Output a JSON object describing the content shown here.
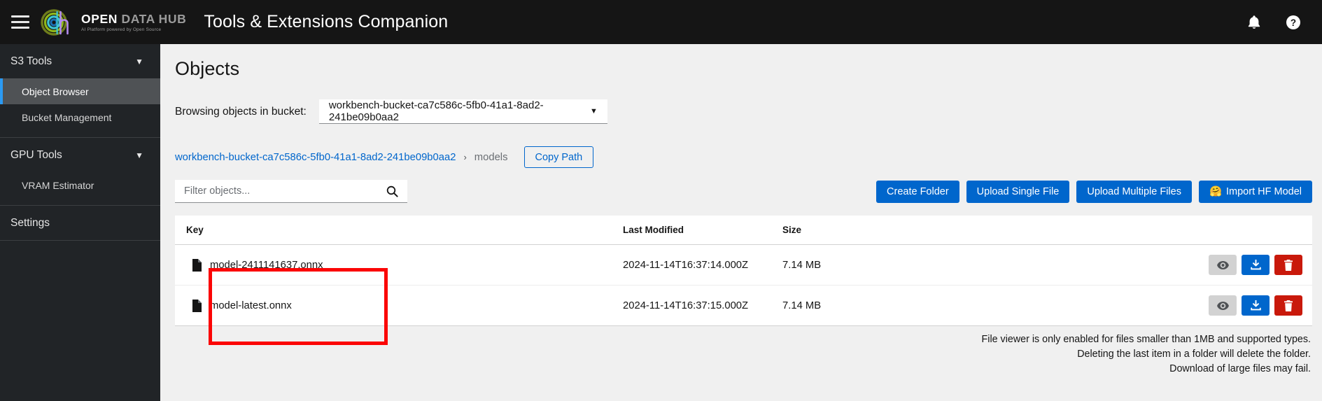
{
  "masthead": {
    "menu_icon": "hamburger-icon",
    "logo": {
      "open": "OPEN",
      "datahub": "DATA HUB",
      "tagline": "AI Platform powered by Open Source"
    },
    "app_title": "Tools & Extensions Companion",
    "notifications_icon": "bell-icon",
    "help_icon": "help-circle-icon"
  },
  "sidebar": {
    "groups": [
      {
        "label": "S3 Tools",
        "expanded": true,
        "items": [
          {
            "label": "Object Browser",
            "active": true
          },
          {
            "label": "Bucket Management",
            "active": false
          }
        ]
      },
      {
        "label": "GPU Tools",
        "expanded": true,
        "items": [
          {
            "label": "VRAM Estimator",
            "active": false
          }
        ]
      }
    ],
    "settings_label": "Settings"
  },
  "main": {
    "page_title": "Objects",
    "bucket": {
      "label": "Browsing objects in bucket:",
      "selected": "workbench-bucket-ca7c586c-5fb0-41a1-8ad2-241be09b0aa2",
      "caret_icon": "chevron-down-icon"
    },
    "breadcrumb": {
      "root": "workbench-bucket-ca7c586c-5fb0-41a1-8ad2-241be09b0aa2",
      "separator": "›",
      "current": "models",
      "copy_path_label": "Copy Path"
    },
    "filter": {
      "placeholder": "Filter objects...",
      "value": "",
      "icon": "search-icon"
    },
    "actions": {
      "create_folder": "Create Folder",
      "upload_single": "Upload Single File",
      "upload_multiple": "Upload Multiple Files",
      "import_hf": "Import HF Model",
      "import_hf_icon": "🤗"
    },
    "table": {
      "columns": [
        "Key",
        "Last Modified",
        "Size"
      ],
      "rows": [
        {
          "icon": "file-icon",
          "key": "model-2411141637.onnx",
          "last_modified": "2024-11-14T16:37:14.000Z",
          "size": "7.14 MB",
          "actions": [
            "view-icon",
            "download-icon",
            "delete-icon"
          ]
        },
        {
          "icon": "file-icon",
          "key": "model-latest.onnx",
          "last_modified": "2024-11-14T16:37:15.000Z",
          "size": "7.14 MB",
          "actions": [
            "view-icon",
            "download-icon",
            "delete-icon"
          ]
        }
      ]
    },
    "footnotes": [
      "File viewer is only enabled for files smaller than 1MB and supported types.",
      "Deleting the last item in a folder will delete the folder.",
      "Download of large files may fail."
    ]
  },
  "annotation": {
    "type": "highlight-rectangle",
    "color": "#fb0505"
  },
  "colors": {
    "masthead_bg": "#151515",
    "sidebar_bg": "#212427",
    "accent_blue": "#0066cc",
    "active_nav": "#2b9af3",
    "danger_red": "#c9190b",
    "page_bg": "#f0f0f0"
  }
}
